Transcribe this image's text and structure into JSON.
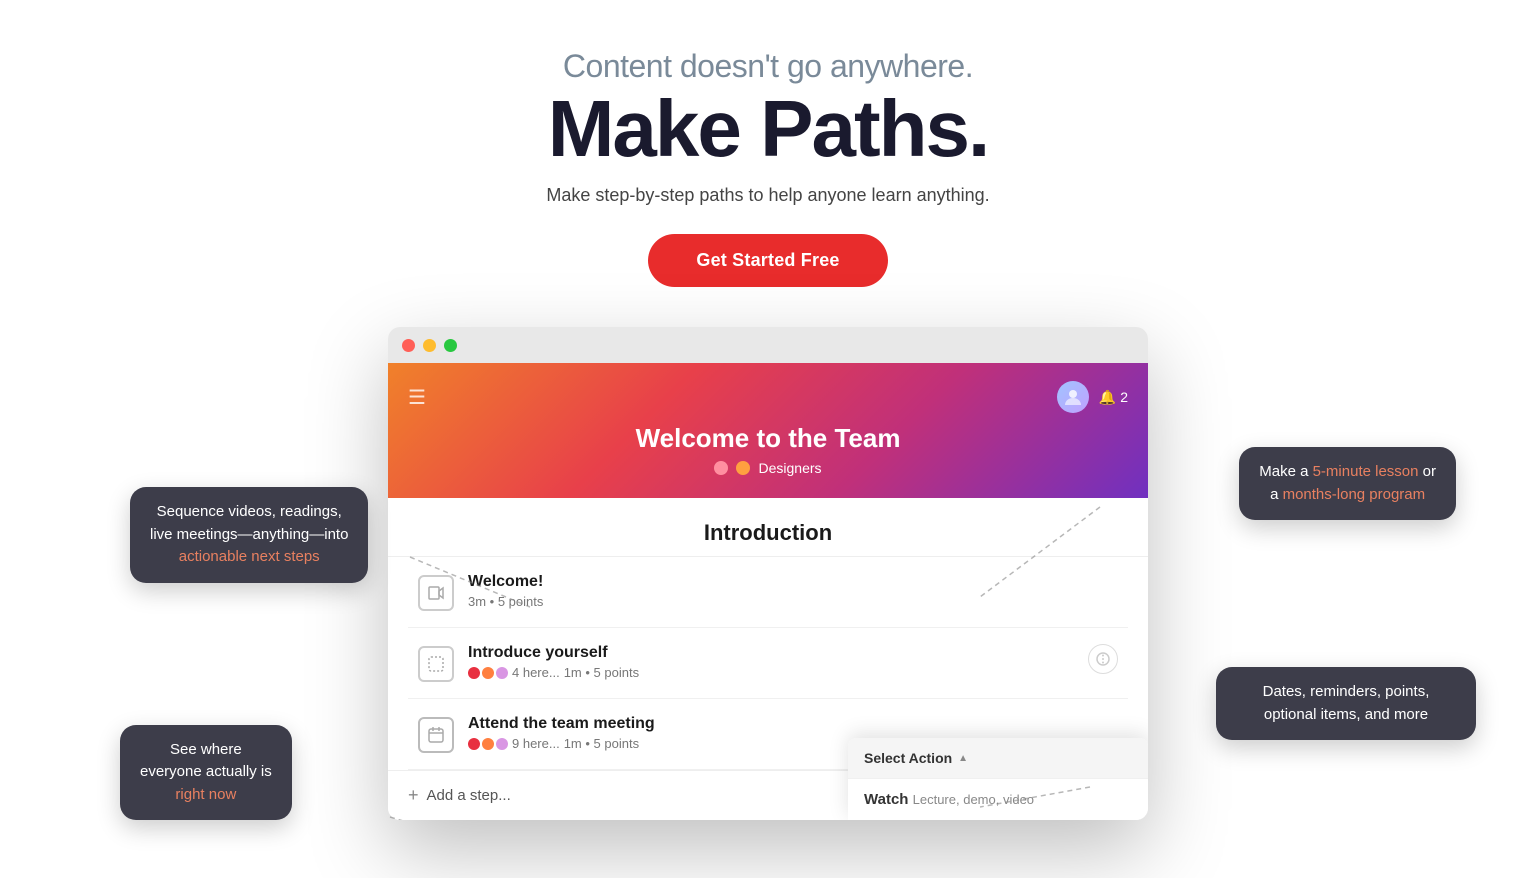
{
  "hero": {
    "subtitle": "Content doesn't go anywhere.",
    "title": "Make Paths.",
    "description": "Make step-by-step paths to help anyone learn anything.",
    "cta_button": "Get Started Free"
  },
  "app_window": {
    "path_title": "Welcome to the Team",
    "path_tag": "Designers",
    "section_title": "Introduction",
    "steps": [
      {
        "name": "Welcome!",
        "meta": "3m • 5 points",
        "icon_type": "video",
        "avatars": []
      },
      {
        "name": "Introduce yourself",
        "meta": "1m • 5 points",
        "avatar_count": "4 here...",
        "icon_type": "task",
        "has_action": true
      },
      {
        "name": "Attend the team meeting",
        "meta": "1m • 5 points",
        "avatar_count": "9 here...",
        "icon_type": "calendar"
      }
    ],
    "add_step_label": "+ Add a step..."
  },
  "dropdown": {
    "header": "Select Action",
    "item_label": "Watch",
    "item_sub": "Lecture, demo, video"
  },
  "tooltips": [
    {
      "id": "sequence",
      "text_parts": [
        "Sequence videos, readings,\nlive meetings—anything—into\n",
        "actionable next steps"
      ],
      "highlight_index": 1,
      "position": "left-top"
    },
    {
      "id": "duration",
      "text_before": "Make a ",
      "highlight1": "5-minute lesson",
      "text_mid": " or\na ",
      "highlight2": "months-long program",
      "position": "right-top"
    },
    {
      "id": "see-where",
      "text_parts": [
        "See where\neveryone actually is\n",
        "right now"
      ],
      "highlight_index": 1,
      "position": "left-bottom"
    },
    {
      "id": "dates",
      "text": "Dates, reminders, points,\noptional items, and more",
      "position": "right-bottom"
    }
  ]
}
